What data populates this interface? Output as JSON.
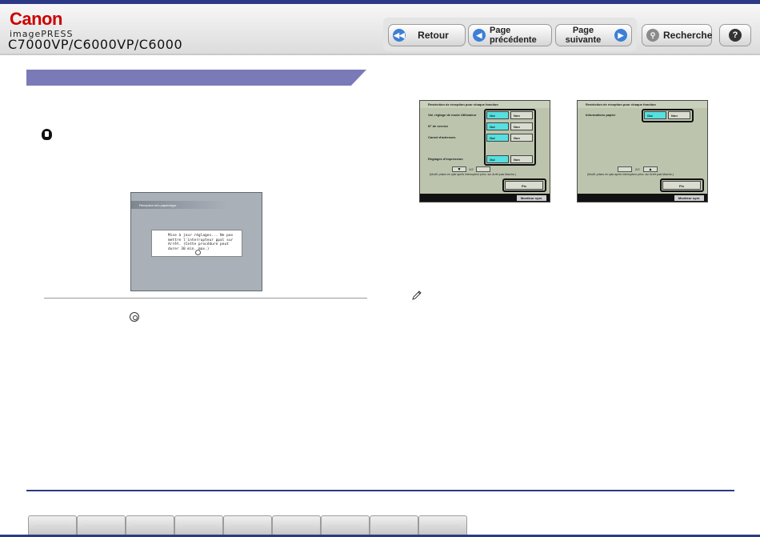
{
  "header": {
    "brand": "Canon",
    "product": "imagePRESS",
    "model": "C7000VP/C6000VP/C6000"
  },
  "nav": {
    "back_label": "Retour",
    "prev_label": "Page précédente",
    "next_label": "Page suivante",
    "search_label": "Recherche",
    "help_label": "?"
  },
  "screen_main": {
    "title": "Réception info papier/type",
    "message": "Mise à jour réglages... Ne pas mettre l'interrupteur ppal sur Arrêt. (Cette procédure peut durer 30 min. max.)"
  },
  "screen_page1": {
    "title": "Restriction de réception pour chaque fonction",
    "rows": [
      {
        "label": "Val. réglage de mode Utilisateur",
        "on": "Oui",
        "off": "Non"
      },
      {
        "label": "N° de service",
        "on": "Oui",
        "off": "Non"
      },
      {
        "label": "Carnet d'adresses",
        "on": "Oui",
        "off": "Non"
      },
      {
        "label": "Réglages d'impression",
        "on": "Oui",
        "off": "Non"
      }
    ],
    "pager": "1/2",
    "hint": "(Modif. prises en cpte après interrupteur princ. sur Arrêt puis Marche.)",
    "finish": "Fin",
    "monitor": "Moniteur syst."
  },
  "screen_page2": {
    "title": "Restriction de réception pour chaque fonction",
    "rows": [
      {
        "label": "Informations papier",
        "on": "Oui",
        "off": "Non"
      }
    ],
    "pager": "2/2",
    "hint": "(Modif. prises en cpte après interrupteur princ. sur Arrêt puis Marche.)",
    "finish": "Fin",
    "monitor": "Moniteur syst."
  },
  "tabs": [
    "",
    "",
    "",
    "",
    "",
    "",
    "",
    "",
    ""
  ],
  "colors": {
    "header_rule": "#2c3a86",
    "section_bar": "#7b7ab8",
    "brand_red": "#cc0000",
    "button_on": "#56e0e0"
  }
}
